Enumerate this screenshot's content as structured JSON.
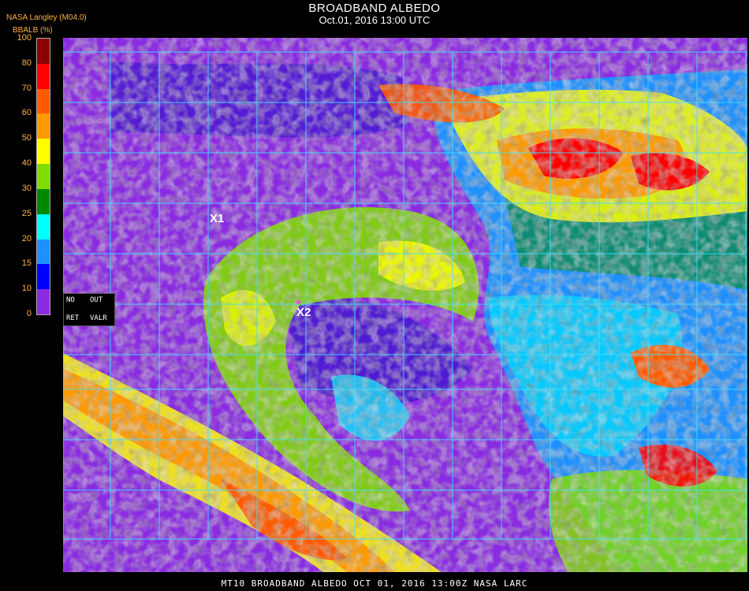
{
  "header": {
    "title": "BROADBAND ALBEDO",
    "subtitle": "Oct.01, 2016 13:00 UTC",
    "source": "NASA Langley (M04.0)",
    "unit": "BBALB (%)"
  },
  "legend": {
    "ticks": [
      "100",
      "80",
      "70",
      "60",
      "50",
      "40",
      "30",
      "25",
      "20",
      "15",
      "10",
      "0"
    ],
    "bands": [
      {
        "from": 80,
        "to": 100,
        "color": "#8b0000"
      },
      {
        "from": 70,
        "to": 80,
        "color": "#ff0000"
      },
      {
        "from": 60,
        "to": 70,
        "color": "#ff5a00"
      },
      {
        "from": 50,
        "to": 60,
        "color": "#ff9900"
      },
      {
        "from": 40,
        "to": 50,
        "color": "#ffff00"
      },
      {
        "from": 30,
        "to": 40,
        "color": "#7fdd00"
      },
      {
        "from": 25,
        "to": 30,
        "color": "#008800"
      },
      {
        "from": 20,
        "to": 25,
        "color": "#00ffff"
      },
      {
        "from": 15,
        "to": 20,
        "color": "#1e90ff"
      },
      {
        "from": 10,
        "to": 15,
        "color": "#0000ff"
      },
      {
        "from": 0,
        "to": 10,
        "color": "#8a2be2"
      }
    ]
  },
  "no_out_box": {
    "no": "NO",
    "out": "OUT",
    "ret": "RET",
    "valr": "VALR"
  },
  "markers": {
    "x1": "X1",
    "x2": "X2"
  },
  "footer": "MT10  BROADBAND ALBEDO   OCT 01, 2016 13:00Z   NASA LARC",
  "colors": {
    "ocean": "#8a2be2",
    "grid": "#40e0ff",
    "label": "#ffb347",
    "marker_dot": "#ff3cff"
  }
}
